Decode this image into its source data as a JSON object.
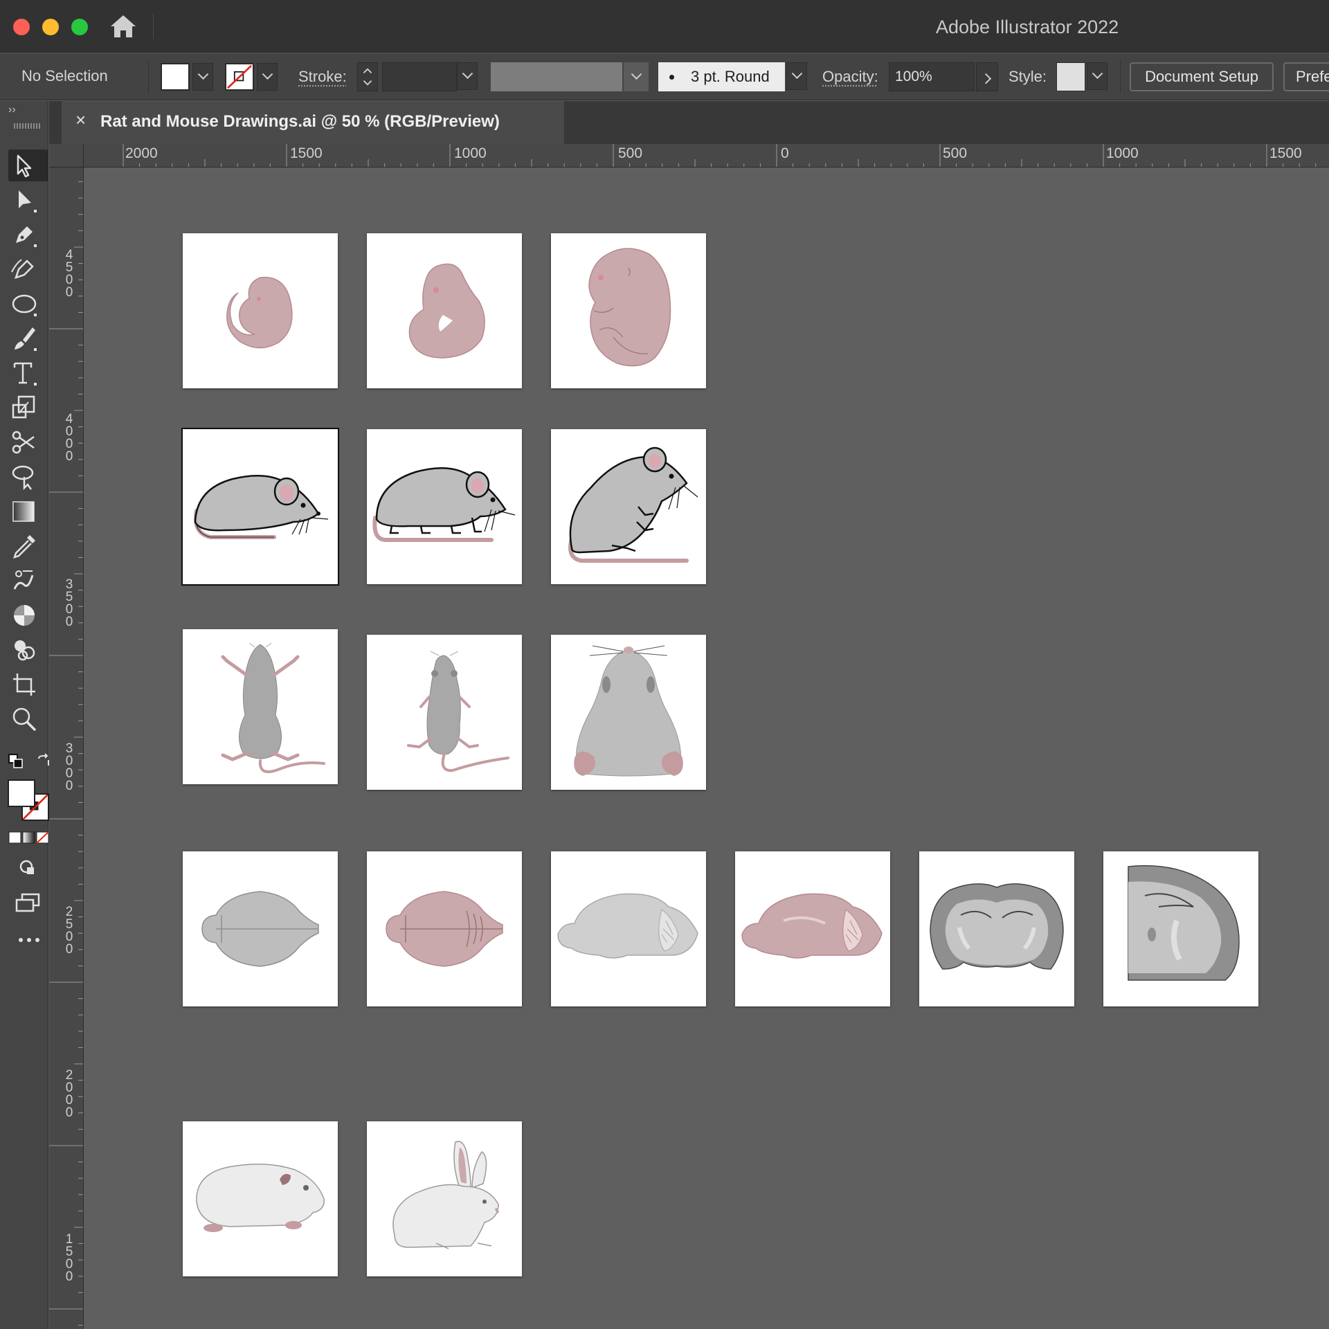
{
  "window": {
    "title": "Adobe Illustrator 2022"
  },
  "controlbar": {
    "selection_status": "No Selection",
    "stroke_label": "Stroke:",
    "brush_label": "3 pt. Round",
    "opacity_label": "Opacity:",
    "opacity_value": "100%",
    "style_label": "Style:",
    "document_setup": "Document Setup",
    "preferences": "Prefe"
  },
  "document": {
    "tab_title": "Rat and Mouse Drawings.ai @ 50 % (RGB/Preview)"
  },
  "rulers": {
    "top": [
      "2000",
      "1500",
      "1000",
      "500",
      "0",
      "500",
      "1000",
      "1500"
    ],
    "left": [
      "4500",
      "4000",
      "3500",
      "3000",
      "2500",
      "2000",
      "1500"
    ]
  },
  "toolbar": {
    "tools": [
      "selection-tool",
      "direct-selection-tool",
      "pen-tool",
      "curvature-tool",
      "ellipse-tool",
      "paintbrush-tool",
      "type-tool",
      "scale-tool",
      "scissors-tool",
      "lasso-tool",
      "gradient-tool",
      "eyedropper-tool",
      "puppet-warp-tool",
      "live-paint-tool",
      "shape-builder-tool",
      "artboard-tool",
      "zoom-tool"
    ]
  },
  "colors": {
    "pink": "#c9a9ac",
    "pink_dark": "#b48a8f",
    "grey": "#bdbdbd",
    "grey_dark": "#8f8f8f",
    "tail": "#c49ca0",
    "white_fur": "#ececec"
  },
  "artboards": [
    "embryo-curled",
    "embryo-mid",
    "embryo-late",
    "mouse-side-lying",
    "mouse-side-walking",
    "mouse-sitting",
    "mouse-ventral",
    "mouse-dorsal",
    "mouse-rear-view",
    "brain-dorsal-grey",
    "brain-dorsal-pink",
    "brain-sagittal-grey",
    "brain-sagittal-pink",
    "brain-coronal-full",
    "brain-coronal-half",
    "guinea-pig",
    "rabbit"
  ]
}
